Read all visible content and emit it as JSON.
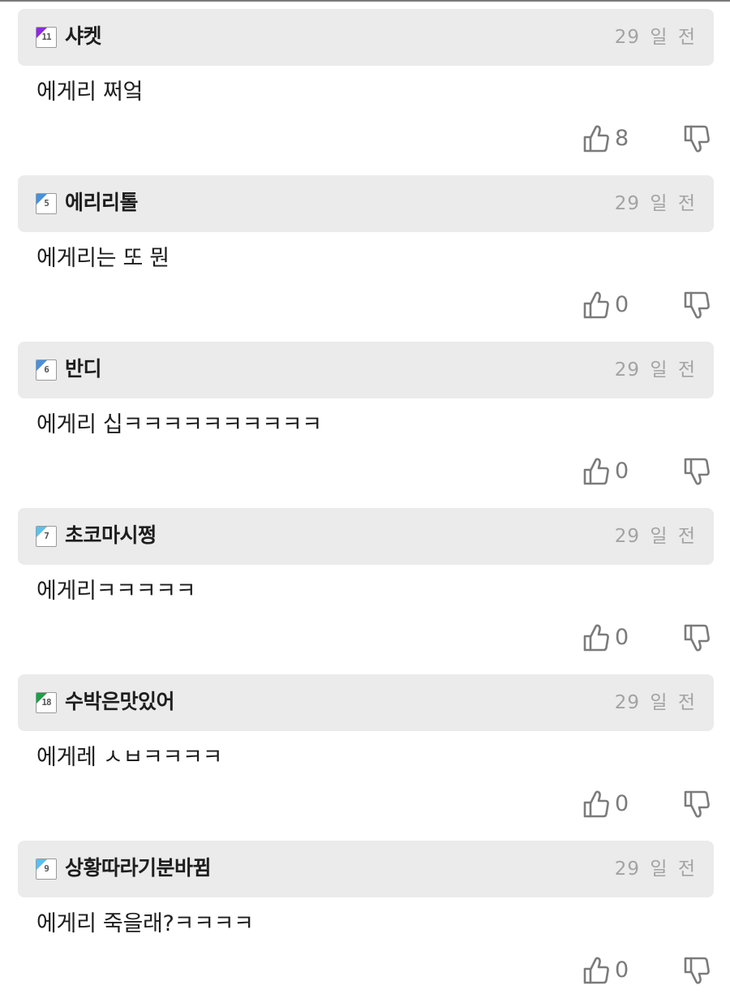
{
  "time_label": "29 일 전",
  "comments": [
    {
      "level": "11",
      "level_color": "#8a2be2",
      "nickname": "샤켓",
      "time": "29 일 전",
      "text": "에게리 쩌엌",
      "upvotes": "8"
    },
    {
      "level": "5",
      "level_color": "#4a90d9",
      "nickname": "에리리톨",
      "time": "29 일 전",
      "text": "에게리는 또 뭔",
      "upvotes": "0"
    },
    {
      "level": "6",
      "level_color": "#4a90d9",
      "nickname": "반디",
      "time": "29 일 전",
      "text": "에게리 십ㅋㅋㅋㅋㅋㅋㅋㅋㅋㅋ",
      "upvotes": "0"
    },
    {
      "level": "7",
      "level_color": "#5bc0eb",
      "nickname": "초코마시쩡",
      "time": "29 일 전",
      "text": "에게리ㅋㅋㅋㅋㅋ",
      "upvotes": "0"
    },
    {
      "level": "18",
      "level_color": "#1e9e4a",
      "nickname": "수박은맛있어",
      "time": "29 일 전",
      "text": "에게레 ㅅㅂㅋㅋㅋㅋ",
      "upvotes": "0"
    },
    {
      "level": "9",
      "level_color": "#5bc0eb",
      "nickname": "상황따라기분바뀜",
      "time": "29 일 전",
      "text": "에게리 죽을래?ㅋㅋㅋㅋ",
      "upvotes": "0"
    }
  ],
  "icons": {
    "badge": "level-badge-icon",
    "up": "thumbs-up-icon",
    "down": "thumbs-down-icon"
  },
  "colors": {
    "header_bg": "#ebebeb",
    "text": "#1e1e1e",
    "meta": "#a3a3a3",
    "icon": "#7b7b7b"
  }
}
